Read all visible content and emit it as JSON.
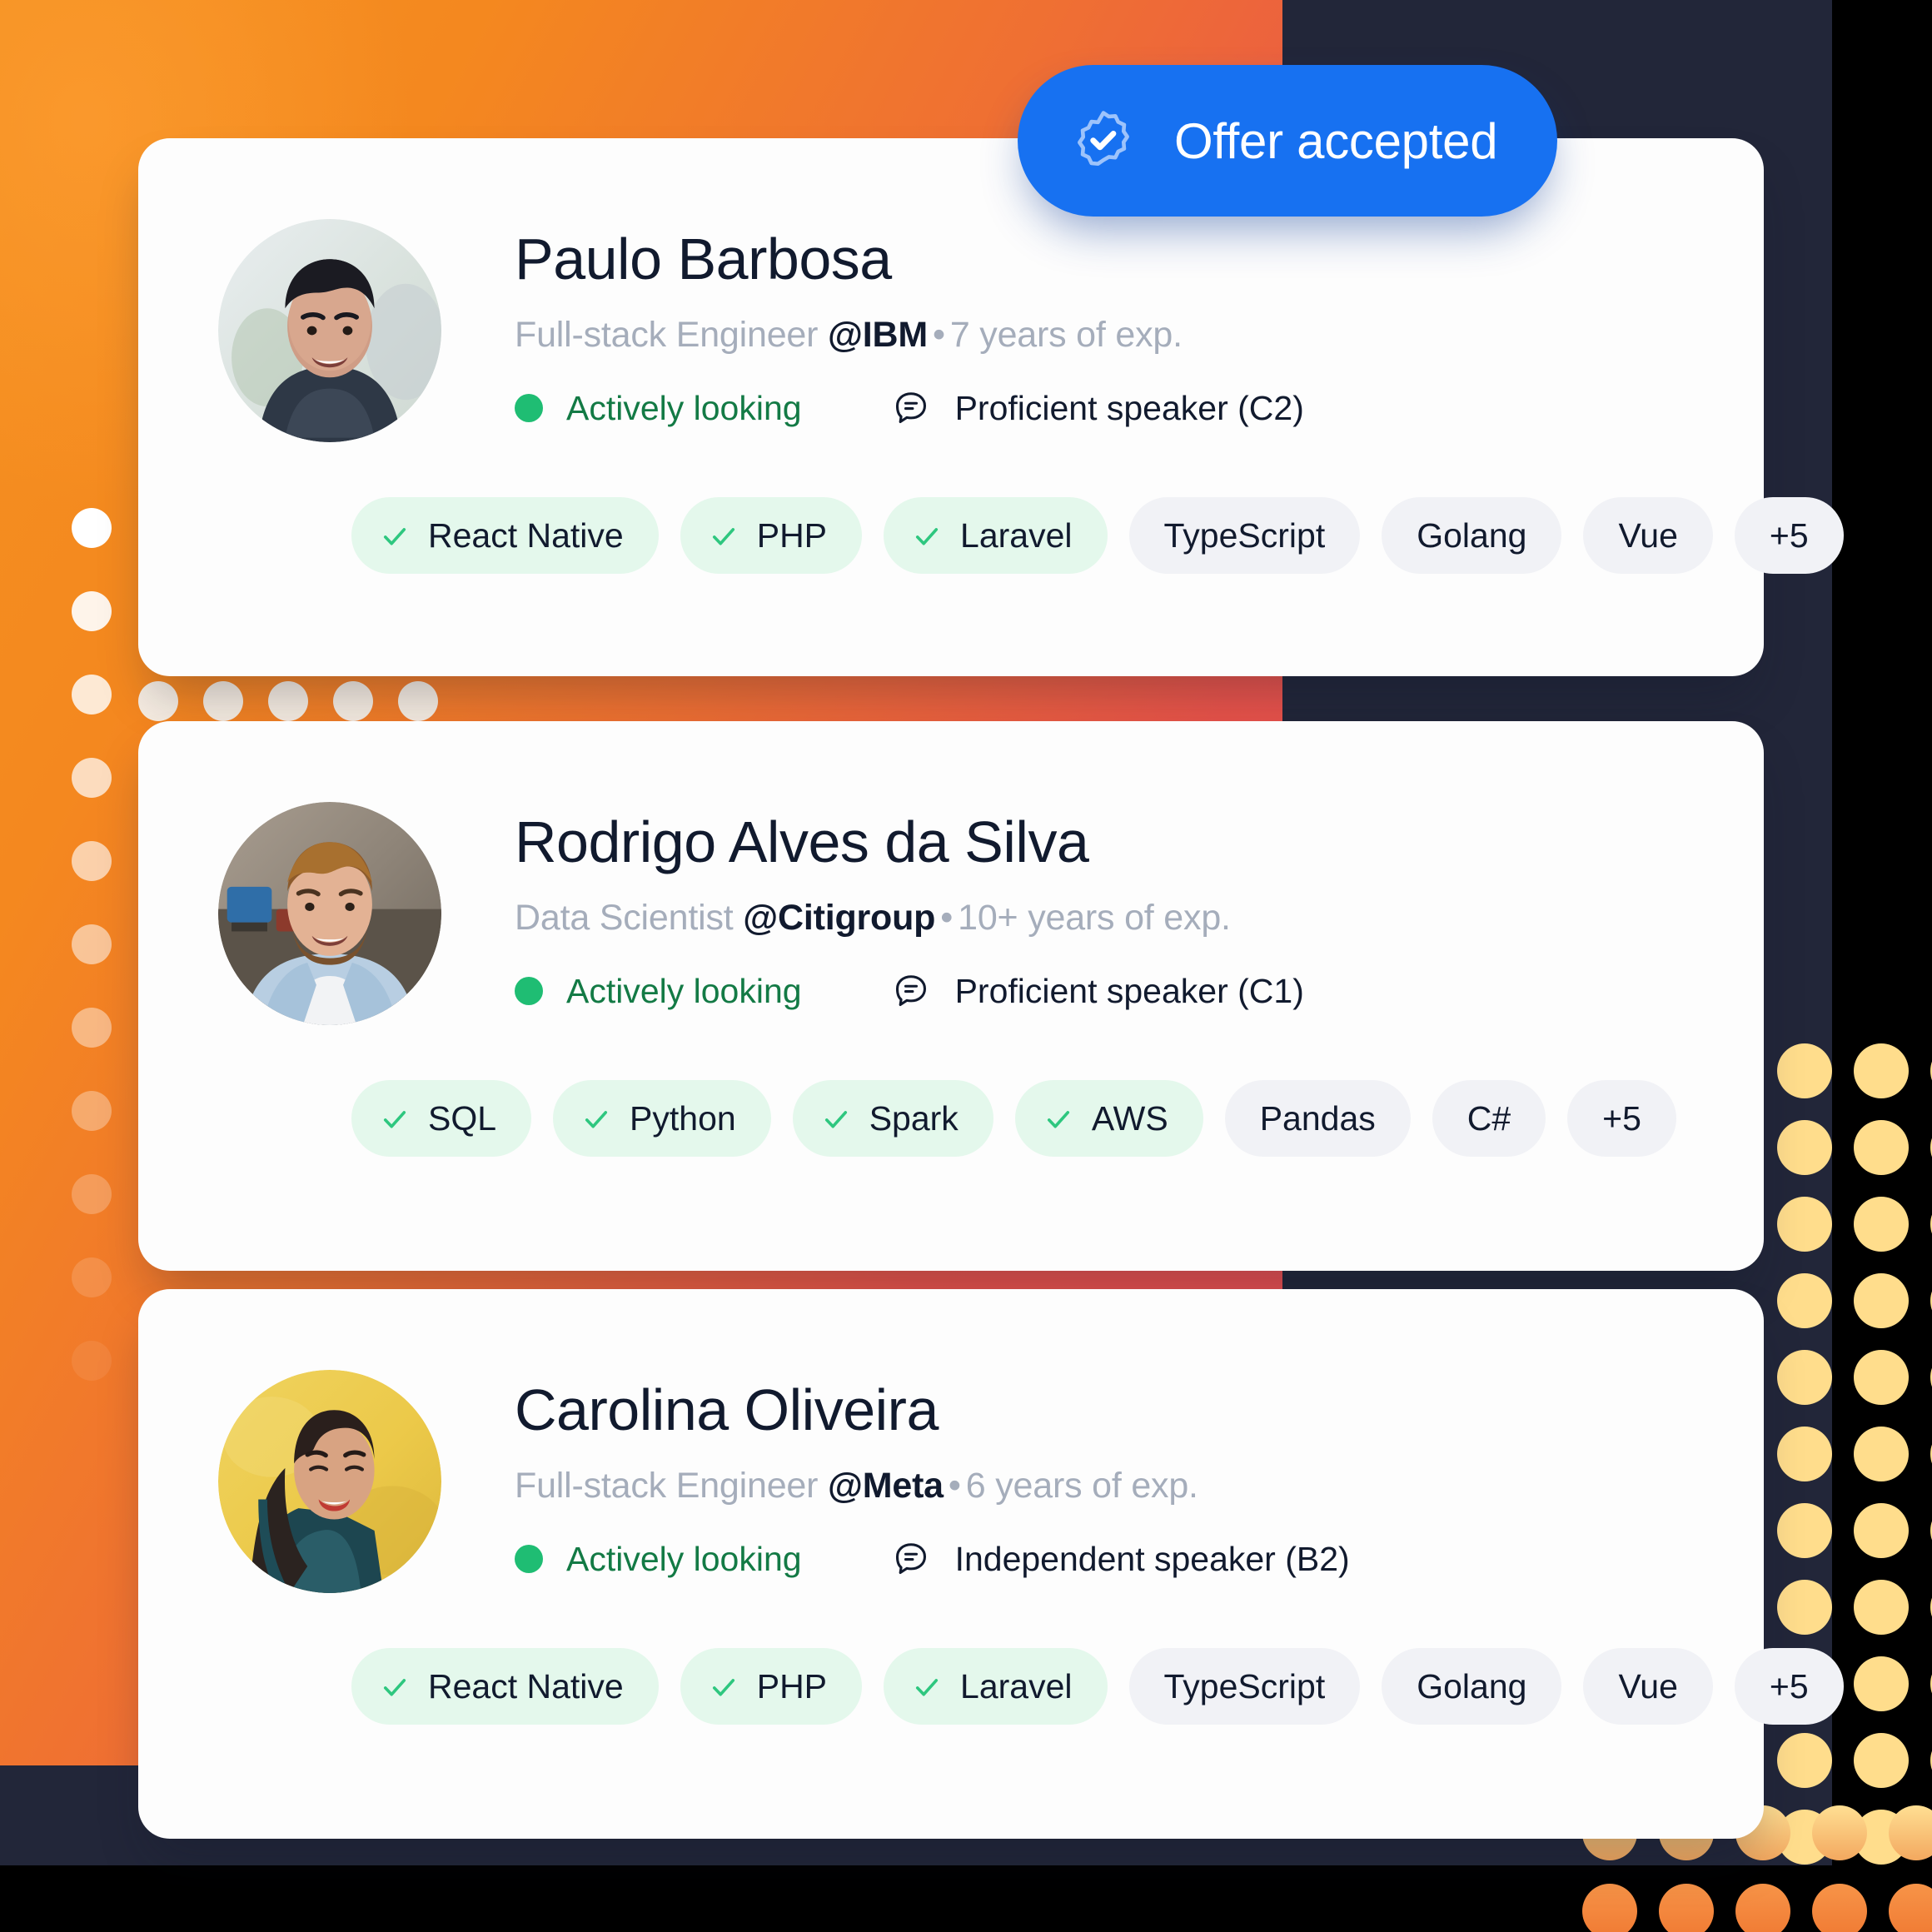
{
  "theme": {
    "accent_blue": "#1771f1",
    "status_green": "#1fbd73",
    "status_green_text": "#137a45",
    "chip_green_bg": "#e4f8ec",
    "chip_gray_bg": "#f1f2f6",
    "card_bg": "#fdfdfd",
    "dark_navy": "#222639",
    "orange_start": "#f59120",
    "red_end": "#e84d55",
    "yellow_dot": "#ffdd8c",
    "text_primary": "#111a2e",
    "text_muted": "#a5adbb"
  },
  "offer_badge": {
    "label": "Offer accepted",
    "icon": "verified-seal-check-icon"
  },
  "candidates": [
    {
      "name": "Paulo Barbosa",
      "role": "Full-stack Engineer",
      "company": "@IBM",
      "separator": "•",
      "experience": "7 years of exp.",
      "status": {
        "label": "Actively looking",
        "icon": "status-dot-icon"
      },
      "language": {
        "label": "Proficient speaker (C2)",
        "icon": "speech-bubble-icon"
      },
      "avatar_alt": "Smiling man with dark hair outdoors",
      "skills": [
        {
          "label": "React Native",
          "verified": true
        },
        {
          "label": "PHP",
          "verified": true
        },
        {
          "label": "Laravel",
          "verified": true
        },
        {
          "label": "TypeScript",
          "verified": false
        },
        {
          "label": "Golang",
          "verified": false
        },
        {
          "label": "Vue",
          "verified": false
        },
        {
          "label": "+5",
          "verified": false
        }
      ]
    },
    {
      "name": "Rodrigo Alves da Silva",
      "role": "Data Scientist",
      "company": "@Citigroup",
      "separator": "•",
      "experience": "10+ years of exp.",
      "status": {
        "label": "Actively looking",
        "icon": "status-dot-icon"
      },
      "language": {
        "label": "Proficient speaker (C1)",
        "icon": "speech-bubble-icon"
      },
      "avatar_alt": "Smiling man with beard in denim shirt in an office",
      "skills": [
        {
          "label": "SQL",
          "verified": true
        },
        {
          "label": "Python",
          "verified": true
        },
        {
          "label": "Spark",
          "verified": true
        },
        {
          "label": "AWS",
          "verified": true
        },
        {
          "label": "Pandas",
          "verified": false
        },
        {
          "label": "C#",
          "verified": false
        },
        {
          "label": "+5",
          "verified": false
        }
      ]
    },
    {
      "name": "Carolina Oliveira",
      "role": "Full-stack Engineer",
      "company": "@Meta",
      "separator": "•",
      "experience": "6 years of exp.",
      "status": {
        "label": "Actively looking",
        "icon": "status-dot-icon"
      },
      "language": {
        "label": "Independent speaker (B2)",
        "icon": "speech-bubble-icon"
      },
      "avatar_alt": "Smiling woman with teal hair against a yellow wall",
      "skills": [
        {
          "label": "React Native",
          "verified": true
        },
        {
          "label": "PHP",
          "verified": true
        },
        {
          "label": "Laravel",
          "verified": true
        },
        {
          "label": "TypeScript",
          "verified": false
        },
        {
          "label": "Golang",
          "verified": false
        },
        {
          "label": "Vue",
          "verified": false
        },
        {
          "label": "+5",
          "verified": false
        }
      ]
    }
  ],
  "decorations": {
    "left_dot_column_count": 11,
    "gap_dot_row_count": 5,
    "right_dot_grid_rows": 11,
    "right_dot_grid_cols": 3,
    "bottom_dot_rows": 2
  }
}
